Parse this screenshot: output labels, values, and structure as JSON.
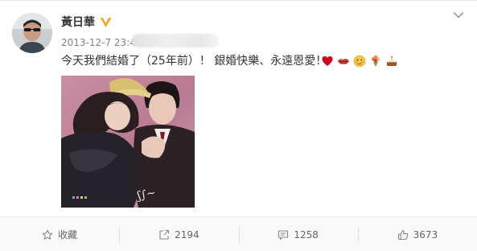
{
  "post": {
    "author": "黃日華",
    "verified": true,
    "timestamp": "2013-12-7 23:43",
    "text": "今天我們結婚了（25年前）！ 銀婚快樂、永遠恩愛！",
    "emojis": [
      "heart-emoji",
      "lips-emoji",
      "blush-emoji",
      "bouquet-emoji",
      "cake-emoji"
    ]
  },
  "actions": {
    "favorite_label": "收藏",
    "repost_count": "2194",
    "comment_count": "1258",
    "like_count": "3673"
  },
  "colors": {
    "verified_badge": "#f5a623",
    "heart": "#d0021b",
    "text_primary": "#333333",
    "text_muted": "#808080"
  }
}
